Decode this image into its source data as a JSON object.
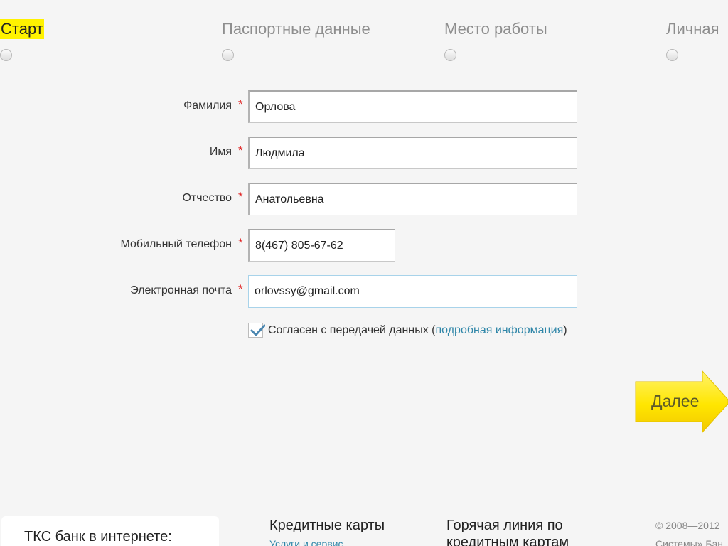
{
  "steps": [
    {
      "label": "Старт",
      "active": true
    },
    {
      "label": "Паспортные данные",
      "active": false
    },
    {
      "label": "Место работы",
      "active": false
    },
    {
      "label": "Личная",
      "active": false
    }
  ],
  "form": {
    "last_name": {
      "label": "Фамилия",
      "value": "Орлова"
    },
    "first_name": {
      "label": "Имя",
      "value": "Людмила"
    },
    "middle_name": {
      "label": "Отчество",
      "value": "Анатольевна"
    },
    "phone": {
      "label": "Мобильный телефон",
      "value": "8(467) 805-67-62"
    },
    "email": {
      "label": "Электронная почта",
      "value": "orlovssy@gmail.com"
    },
    "required_mark": "*",
    "consent": {
      "checked": true,
      "text": "Согласен с передачей данных",
      "open_paren": "(",
      "link": "подробная информация",
      "close_paren": ")"
    }
  },
  "next_button": {
    "label": "Далее"
  },
  "footer": {
    "box_title": "ТКС банк в интернете:",
    "col1_title": "Кредитные карты",
    "col1_link": "Услуги и сервис",
    "col2_title_line1": "Горячая линия по",
    "col2_title_line2": "кредитным картам",
    "copyright_line1": "© 2008—2012",
    "copyright_line2": "Системы» Бан"
  },
  "colors": {
    "active_step_highlight": "#fff200",
    "link": "#2f86a8",
    "required": "#e02020",
    "button_yellow": "#ffe600"
  }
}
